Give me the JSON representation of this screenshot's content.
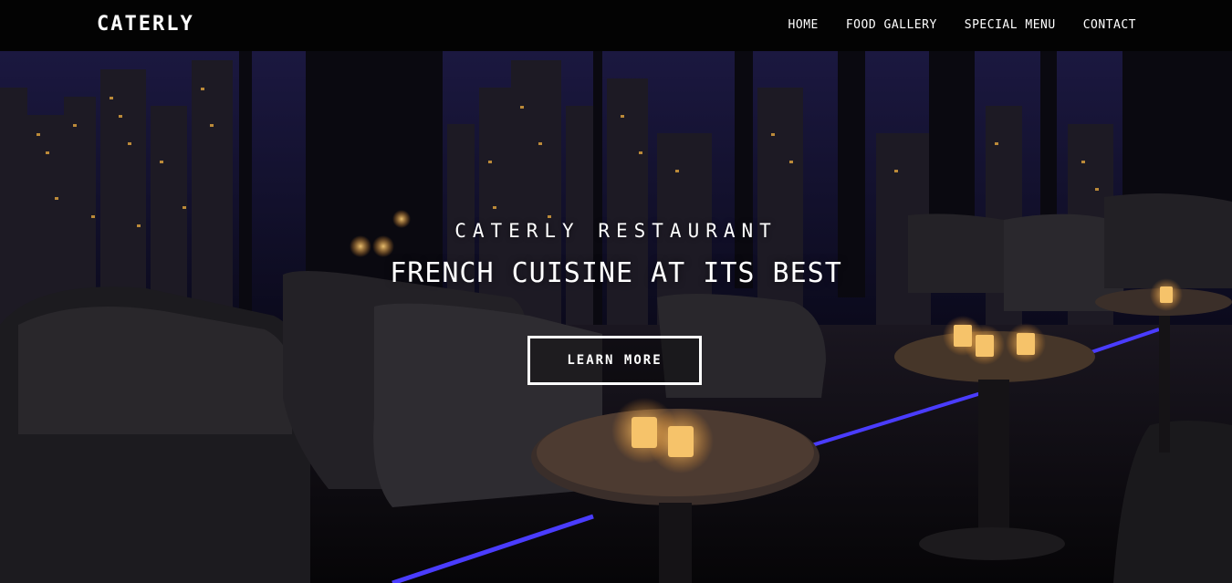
{
  "brand": "CATERLY",
  "nav": {
    "home": "HOME",
    "food_gallery": "FOOD GALLERY",
    "special_menu": "SPECIAL MENU",
    "contact": "CONTACT"
  },
  "hero": {
    "subtitle": "CATERLY RESTAURANT",
    "title": "FRENCH CUISINE AT ITS BEST",
    "cta_label": "LEARN MORE"
  },
  "colors": {
    "navbar": "#030303",
    "text": "#ffffff",
    "neon_accent": "#4a3cff"
  }
}
